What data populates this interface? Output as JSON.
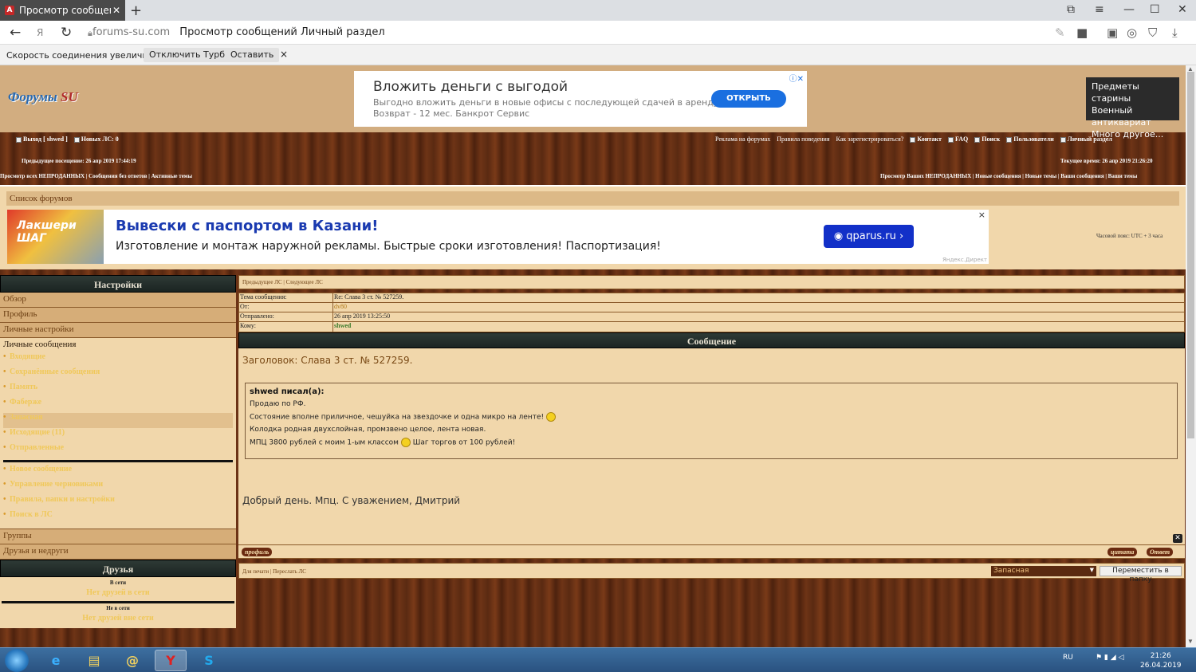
{
  "browser": {
    "tab_title": "Просмотр сообщений /",
    "tab_icon": "opera-like-logo-icon",
    "new_tab": "+",
    "domain": "forums-su.com",
    "page_title": "Просмотр сообщений Личный раздел"
  },
  "turbo": {
    "message": "Скорость соединения увеличилась.",
    "disable_label": "Отключить Турбо",
    "keep_label": "Оставить",
    "close": "×"
  },
  "header": {
    "logo_text": "Форумы",
    "logo_su": "SU"
  },
  "ad_top": {
    "headline": "Вложить деньги с выгодой",
    "line1": "Выгодно вложить деньги в новые офисы с последующей сдачей в аренду.",
    "line2": "Возврат - 12 мес. Банкрот Сервис",
    "button": "ОТКРЫТЬ"
  },
  "ad_right": {
    "line1": "Предметы старины",
    "line2": "Военный антиквариат",
    "line3": "Много другое..."
  },
  "toolbar": {
    "logout": "Выход [ shwed ]",
    "new_pm": "Новых ЛС: 0",
    "ads": "Реклама на форумах",
    "rules": "Правила поведения",
    "register": "Как зарегистрироваться?",
    "contact": "Контакт",
    "faq": "FAQ",
    "search": "Поиск",
    "users": "Пользователи",
    "personal": "Личный раздел"
  },
  "visit": {
    "last": "Предыдущее посещение: 26 апр 2019 17:44:19",
    "now": "Текущее время: 26 апр 2019 21:26:20"
  },
  "quicklinks": {
    "left": "Просмотр всех НЕПРОДАННЫХ | Сообщения без ответов | Активные темы",
    "right": "Просмотр Ваших НЕПРОДАННЫХ | Новые сообщения | Новые темы | Ваши сообщения | Ваши темы"
  },
  "forumlist": {
    "title": "Список форумов",
    "timezone": "Часовой пояс: UTC + 3 часа"
  },
  "ad_banner": {
    "image_text": "Лакшери ШАГ",
    "headline": "Вывески с паспортом в Казани!",
    "text": "Изготовление и монтаж наружной рекламы. Быстрые сроки изготовления! Паспортизация!",
    "button": "qparus.ru",
    "close": "×",
    "source": "Яндекс.Директ"
  },
  "sidebar": {
    "settings_title": "Настройки",
    "overview": "Обзор",
    "profile": "Профиль",
    "personal_settings": "Личные настройки",
    "pm_title": "Личные сообщения",
    "pm_items": [
      "Входящие",
      "Сохранённые сообщения",
      "Память",
      "Фаберже",
      "Запасная",
      "Исходящие (11)",
      "Отправленные"
    ],
    "pm_actions": [
      "Новое сообщение",
      "Управление черновиками",
      "Правила, папки и настройки",
      "Поиск в ЛС"
    ],
    "groups": "Группы",
    "friends_foes": "Друзья и недруги",
    "friends_title": "Друзья",
    "online_label": "В сети",
    "online_none": "Нет друзей в сети",
    "offline_label": "Не в сети",
    "offline_none": "Нет друзей вне сети"
  },
  "message": {
    "nav": "Предыдущее ЛС | Следующее ЛС",
    "subject_label": "Тема сообщения:",
    "subject": "Re: Слава 3 ст. № 527259.",
    "from_label": "От:",
    "from": "dv80",
    "sent_label": "Отправлено:",
    "sent": "26 апр 2019 13:25:50",
    "to_label": "Кому:",
    "to": "shwed",
    "header": "Сообщение",
    "title": "Заголовок: Слава 3 ст. № 527259.",
    "quote_author": "shwed писал(а):",
    "quote_lines": [
      "Продаю по РФ.",
      "Состояние вполне приличное, чешуйка на звездочке и одна микро на ленте!",
      "Колодка родная двухслойная, промзвено целое, лента новая.",
      "МПЦ 3800 рублей с моим 1-ым классом",
      "Шаг торгов от 100 рублей!"
    ],
    "reply_text": "Добрый день. Мпц. С уважением, Дмитрий",
    "profile_btn": "профиль",
    "quote_btn": "цитата",
    "reply_btn": "Ответ",
    "print": "Для печати | Переслать ЛС",
    "folder_selected": "Запасная",
    "move_btn": "Переместить в папку"
  },
  "taskbar": {
    "lang": "RU",
    "time": "21:26",
    "date": "26.04.2019"
  }
}
